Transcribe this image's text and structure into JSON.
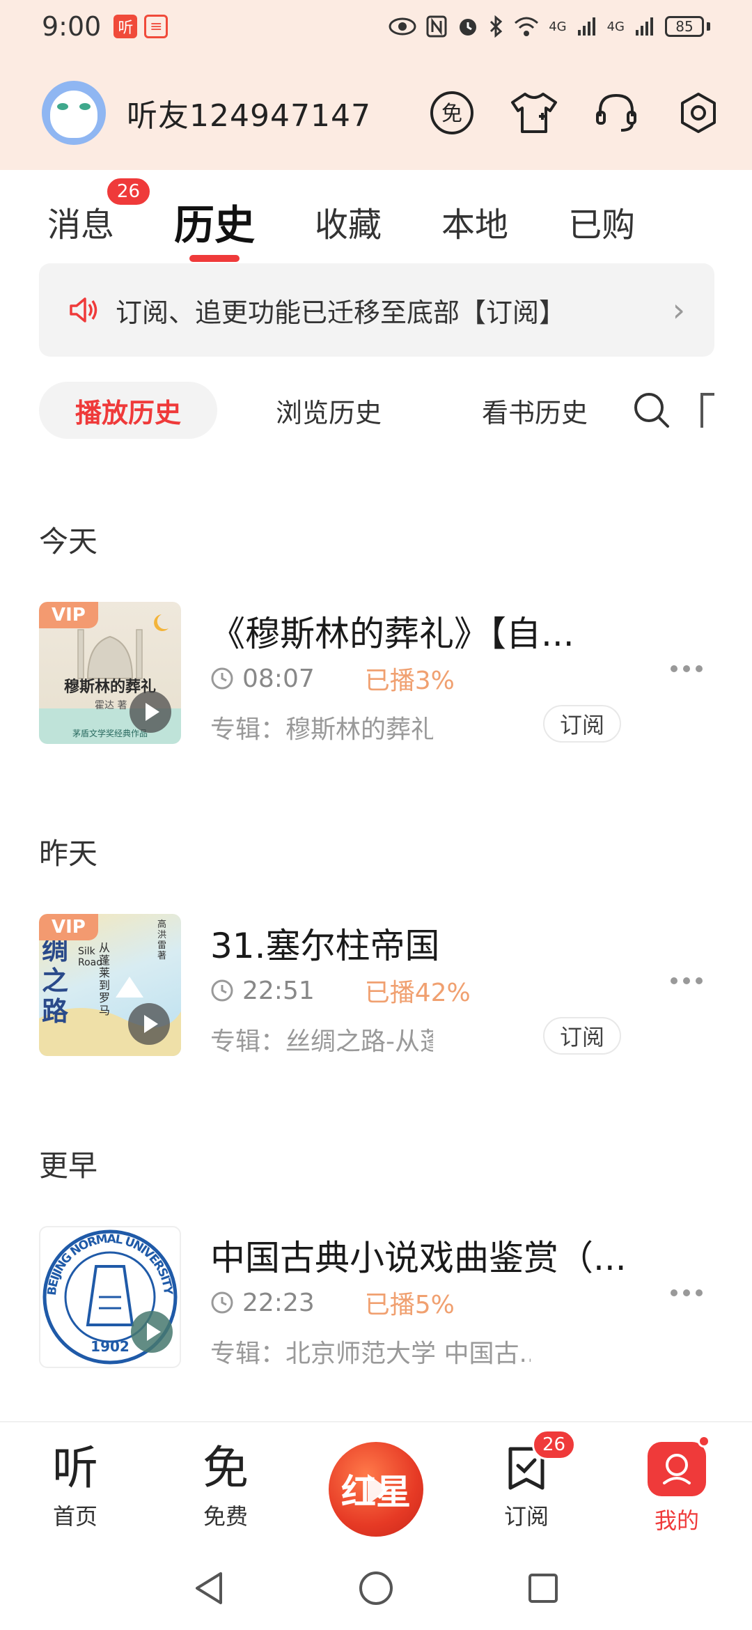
{
  "status_bar": {
    "time": "9:00",
    "app_icon_1": "听",
    "app_icon_2": "≡",
    "network_1": "4G",
    "network_2": "4G",
    "battery": "85"
  },
  "profile": {
    "username": "听友124947147",
    "icons": [
      "vip-free-icon",
      "tshirt-icon",
      "headset-icon",
      "settings-icon"
    ],
    "free_icon_text": "免"
  },
  "tabs": [
    {
      "label": "消息",
      "badge": "26"
    },
    {
      "label": "历史"
    },
    {
      "label": "收藏"
    },
    {
      "label": "本地"
    },
    {
      "label": "已购"
    }
  ],
  "notice": {
    "text": "订阅、追更功能已迁移至底部【订阅】"
  },
  "subtabs": [
    {
      "label": "播放历史"
    },
    {
      "label": "浏览历史"
    },
    {
      "label": "看书历史"
    }
  ],
  "sections": [
    {
      "label": "今天",
      "items": [
        {
          "title": "《穆斯林的葬礼》【自...",
          "time": "08:07",
          "progress": "已播3%",
          "album": "专辑：穆斯林的葬礼 | ...",
          "subscribe": "订阅",
          "vip": "VIP",
          "cover_title": "穆斯林的葬礼",
          "cover_author": "霍达 著",
          "cover_caption": "茅盾文学奖经典作品"
        }
      ]
    },
    {
      "label": "昨天",
      "items": [
        {
          "title": "31.塞尔柱帝国",
          "time": "22:51",
          "progress": "已播42%",
          "album": "专辑：丝绸之路-从蓬...",
          "subscribe": "订阅",
          "vip": "VIP",
          "cover_title": "绸之路",
          "cover_author": "高洪雷 著",
          "cover_subtitle": "从蓬莱到罗马",
          "cover_en": "Silk Road"
        }
      ]
    },
    {
      "label": "更早",
      "items": [
        {
          "title": "中国古典小说戏曲鉴赏（...",
          "time": "22:23",
          "progress": "已播5%",
          "album": "专辑：北京师范大学 中国古...",
          "cover_ring": "BEIJING NORMAL UNIVERSITY",
          "cover_year": "1902"
        }
      ]
    }
  ],
  "bottom_nav": [
    {
      "label": "首页",
      "glyph": "听"
    },
    {
      "label": "免费",
      "glyph": "免"
    },
    {
      "label": "",
      "glyph": "红星"
    },
    {
      "label": "订阅",
      "badge": "26"
    },
    {
      "label": "我的"
    }
  ],
  "colors": {
    "accent": "#ef3a3a",
    "header_bg": "#fcebe2",
    "progress": "#f0a070"
  }
}
